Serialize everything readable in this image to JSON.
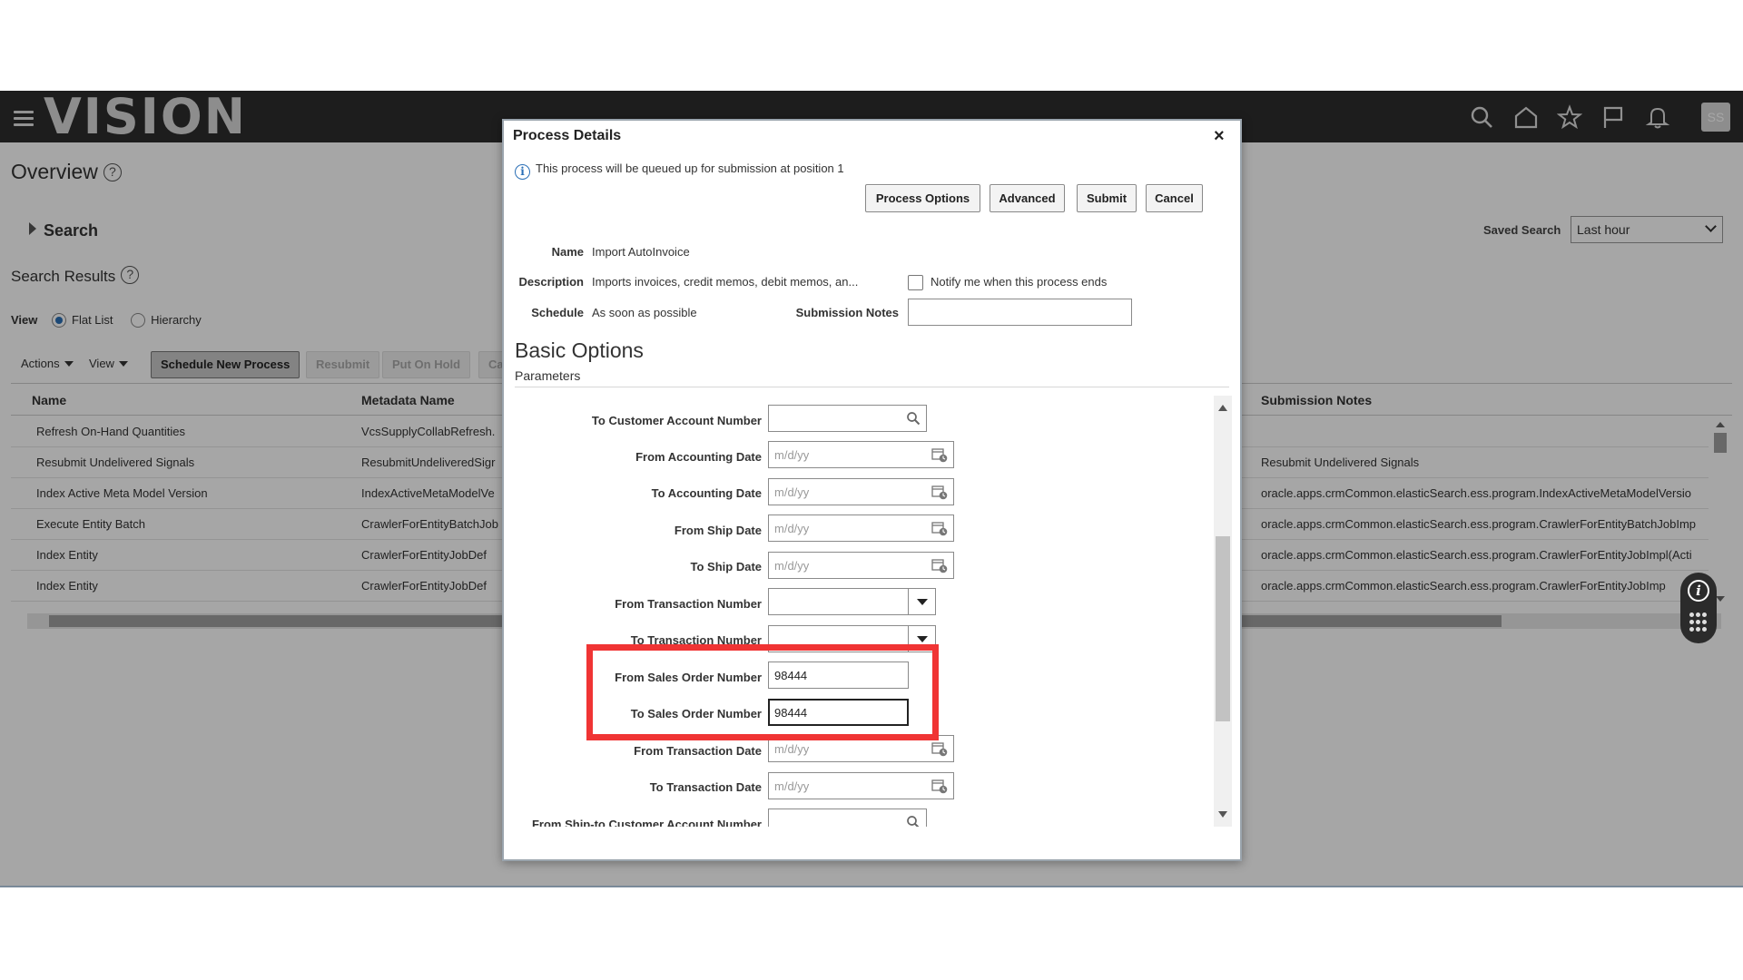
{
  "topbar": {
    "logo": "VISION",
    "avatar_initials": "SS",
    "icons": [
      "search-icon",
      "home-icon",
      "star-icon",
      "flag-icon",
      "bell-icon"
    ]
  },
  "page": {
    "title": "Overview",
    "search_label": "Search",
    "saved_search_label": "Saved Search",
    "saved_search_value": "Last hour",
    "search_results_label": "Search Results",
    "view_label": "View",
    "view_options": [
      "Flat List",
      "Hierarchy"
    ],
    "toolbar": {
      "actions": "Actions",
      "view": "View",
      "schedule_new_process": "Schedule New Process",
      "resubmit": "Resubmit",
      "put_on_hold": "Put On Hold",
      "cancel_truncated": "Ca"
    },
    "columns": {
      "name": "Name",
      "metadata_name": "Metadata Name",
      "submission_notes": "Submission Notes"
    },
    "rows": [
      {
        "name": "Refresh On-Hand Quantities",
        "metadata": "VcsSupplyCollabRefresh.",
        "notes": ""
      },
      {
        "name": "Resubmit Undelivered Signals",
        "metadata": "ResubmitUndeliveredSigr",
        "notes": "Resubmit Undelivered Signals"
      },
      {
        "name": "Index Active Meta Model Version",
        "metadata": "IndexActiveMetaModelVe",
        "notes": "oracle.apps.crmCommon.elasticSearch.ess.program.IndexActiveMetaModelVersio"
      },
      {
        "name": "Execute Entity Batch",
        "metadata": "CrawlerForEntityBatchJob",
        "notes": "oracle.apps.crmCommon.elasticSearch.ess.program.CrawlerForEntityBatchJobImp"
      },
      {
        "name": "Index Entity",
        "metadata": "CrawlerForEntityJobDef",
        "notes": "oracle.apps.crmCommon.elasticSearch.ess.program.CrawlerForEntityJobImpl(Acti"
      },
      {
        "name": "Index Entity",
        "metadata": "CrawlerForEntityJobDef",
        "notes": "oracle.apps.crmCommon.elasticSearch.ess.program.CrawlerForEntityJobImp"
      }
    ]
  },
  "dialog": {
    "title": "Process Details",
    "close": "×",
    "info_message": "This process will be queued up for submission at position 1",
    "buttons": {
      "process_options": "Process Options",
      "advanced": "Advanced",
      "submit": "Submit",
      "cancel": "Cancel"
    },
    "name_label": "Name",
    "name_value": "Import AutoInvoice",
    "description_label": "Description",
    "description_value": "Imports invoices, credit memos, debit memos, an...",
    "notify_label": "Notify me when this process ends",
    "schedule_label": "Schedule",
    "schedule_value": "As soon as possible",
    "submission_notes_label": "Submission Notes",
    "basic_options": "Basic Options",
    "parameters": "Parameters",
    "date_placeholder": "m/d/yy",
    "fields": {
      "to_customer_account_number": "To Customer Account Number",
      "from_accounting_date": "From Accounting Date",
      "to_accounting_date": "To Accounting Date",
      "from_ship_date": "From Ship Date",
      "to_ship_date": "To Ship Date",
      "from_transaction_number": "From Transaction Number",
      "to_transaction_number": "To Transaction Number",
      "from_sales_order_number": "From Sales Order Number",
      "from_sales_order_value": "98444",
      "to_sales_order_number": "To Sales Order Number",
      "to_sales_order_value": "98444",
      "from_transaction_date": "From Transaction Date",
      "to_transaction_date": "To Transaction Date",
      "from_ship_to_customer_account_number": "From Ship-to Customer Account Number"
    }
  },
  "colors": {
    "topbar": "#2d2d2d",
    "highlight": "#f03434",
    "info_blue": "#2a6fb6"
  }
}
